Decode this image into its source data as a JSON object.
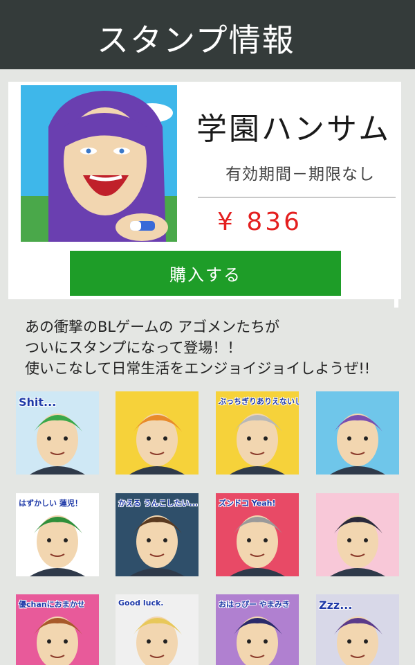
{
  "header": {
    "title": "スタンプ情報"
  },
  "product": {
    "title": "学園ハンサム",
    "period": "有効期間－期限なし",
    "price": "¥ 836",
    "buy_label": "購入する"
  },
  "description": [
    "あの衝撃のBLゲームの アゴメンたちが",
    "ついにスタンプになって登場！！",
    "使いこなして日常生活をエンジョイジョイしようぜ!!"
  ],
  "stickers": [
    {
      "caption": "Shit...",
      "bg": "#cfe8f5",
      "hair": "#3aa84a"
    },
    {
      "caption": "",
      "bg": "#f6d23a",
      "hair": "#e88a2a"
    },
    {
      "caption": "ぶっちぎりありえないし",
      "bg": "#f6d23a",
      "hair": "#b8b8b8"
    },
    {
      "caption": "",
      "bg": "#6fc6ea",
      "hair": "#7a4fb0"
    },
    {
      "caption": "はずかしい 蓮児！",
      "bg": "#ffffff",
      "hair": "#2f8f3a"
    },
    {
      "caption": "かえる うんこしたい...",
      "bg": "#2f4f6a",
      "hair": "#5a3a20"
    },
    {
      "caption": "ズンドコ Yeah!",
      "bg": "#e84a66",
      "hair": "#9a9a9a"
    },
    {
      "caption": "",
      "bg": "#f8c8d8",
      "hair": "#2a2a3a"
    },
    {
      "caption": "優chanにおまかせ",
      "bg": "#e85a9a",
      "hair": "#a85a2a"
    },
    {
      "caption": "Good luck.",
      "bg": "#f0f0f0",
      "hair": "#e8c85a"
    },
    {
      "caption": "おはっぴー やまみき",
      "bg": "#b080d0",
      "hair": "#2a2a6a"
    },
    {
      "caption": "Zzz...",
      "bg": "#d8d8e8",
      "hair": "#5a3a8a"
    }
  ]
}
